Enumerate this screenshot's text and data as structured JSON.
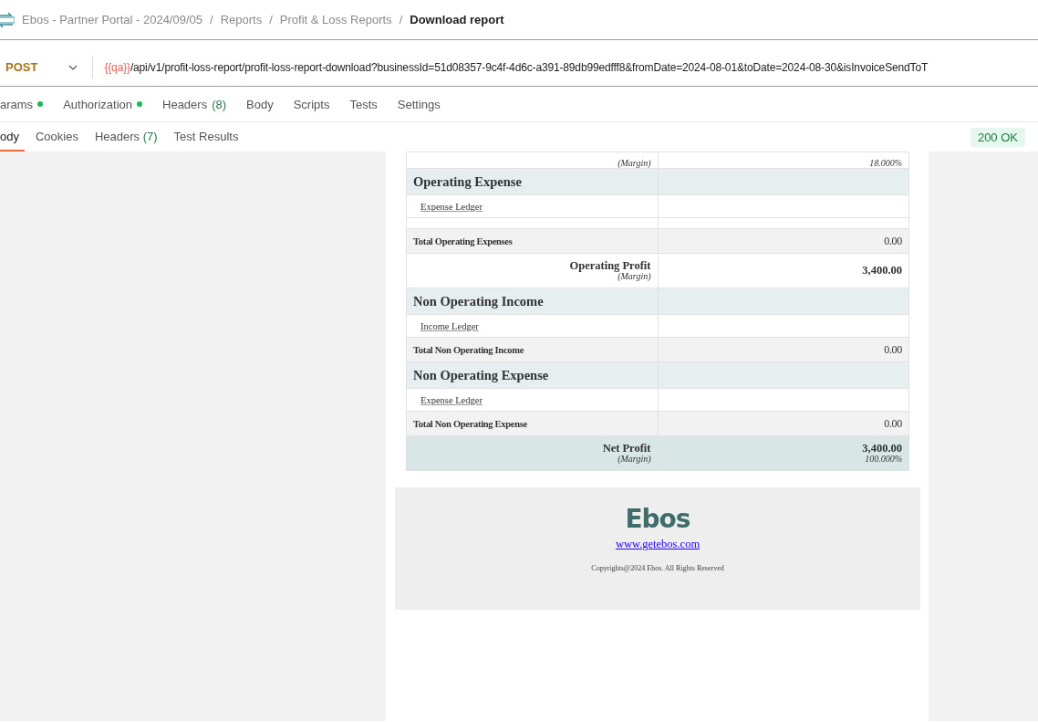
{
  "breadcrumb": {
    "items": [
      "Ebos - Partner Portal - 2024/09/05",
      "Reports",
      "Profit & Loss Reports"
    ],
    "separator": "/",
    "current": "Download report"
  },
  "request": {
    "method": "POST",
    "url_variable": "{{qa}}",
    "url": "/api/v1/profit-loss-report/profit-loss-report-download?businessId=51d08357-9c4f-4d6c-a391-89db99edfff8&fromDate=2024-08-01&toDate=2024-08-30&isInvoiceSendToT"
  },
  "request_tabs": [
    {
      "label": "arams",
      "dot": true
    },
    {
      "label": "Authorization",
      "dot": true
    },
    {
      "label": "Headers",
      "dot": false,
      "count": "(8)"
    },
    {
      "label": "Body",
      "dot": false
    },
    {
      "label": "Scripts",
      "dot": false
    },
    {
      "label": "Tests",
      "dot": false
    },
    {
      "label": "Settings",
      "dot": false
    }
  ],
  "response_tabs": [
    {
      "label": "ody",
      "selected": true
    },
    {
      "label": "Cookies",
      "selected": false
    },
    {
      "label": "Headers",
      "count": "(7)",
      "selected": false
    },
    {
      "label": "Test Results",
      "selected": false
    }
  ],
  "status": "200 OK",
  "report": {
    "rows": [
      {
        "kind": "margin",
        "label": "(Margin)",
        "value": "18.000%"
      },
      {
        "kind": "section",
        "label": "Operating Expense"
      },
      {
        "kind": "ledger",
        "label": "Expense Ledger"
      },
      {
        "kind": "blank"
      },
      {
        "kind": "total",
        "label": "Total Operating Expenses",
        "value": "0.00"
      },
      {
        "kind": "profit",
        "label": "Operating Profit",
        "sub": "(Margin)",
        "value": "3,400.00"
      },
      {
        "kind": "section",
        "label": "Non Operating Income"
      },
      {
        "kind": "ledger",
        "label": "Income Ledger"
      },
      {
        "kind": "total",
        "label": "Total Non Operating Income",
        "value": "0.00"
      },
      {
        "kind": "section",
        "label": "Non Operating Expense"
      },
      {
        "kind": "ledger",
        "label": "Expense Ledger"
      },
      {
        "kind": "total",
        "label": "Total Non Operating Expense",
        "value": "0.00"
      },
      {
        "kind": "net",
        "label": "Net Profit",
        "sub": "(Margin)",
        "value": "3,400.00",
        "subvalue": "100.000%"
      }
    ],
    "footer": {
      "logo": "Ebos",
      "link": "www.getebos.com",
      "copyright": "Copyrights@2024 Ebos. All Rights Reserved"
    }
  }
}
